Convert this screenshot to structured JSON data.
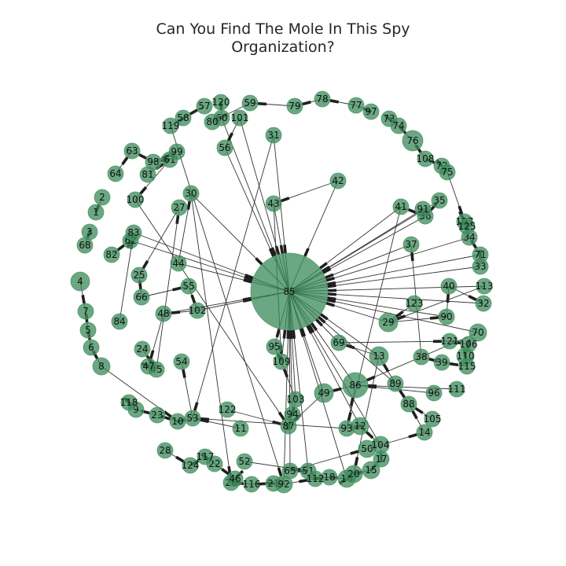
{
  "title_lines": [
    "Can You Find The Mole In This Spy",
    "Organization?"
  ],
  "colors": {
    "node_fill": "#3b8a5a",
    "node_stroke": "#4f9a6a",
    "edge": "#333333",
    "background": "#ffffff"
  },
  "diagram": {
    "type": "directed network graph",
    "nodes": [
      {
        "id": "1"
      },
      {
        "id": "2"
      },
      {
        "id": "3"
      },
      {
        "id": "4"
      },
      {
        "id": "5"
      },
      {
        "id": "6"
      },
      {
        "id": "7"
      },
      {
        "id": "8"
      },
      {
        "id": "9"
      },
      {
        "id": "10"
      },
      {
        "id": "11"
      },
      {
        "id": "12"
      },
      {
        "id": "13"
      },
      {
        "id": "14"
      },
      {
        "id": "15"
      },
      {
        "id": "16"
      },
      {
        "id": "17"
      },
      {
        "id": "18"
      },
      {
        "id": "20"
      },
      {
        "id": "21"
      },
      {
        "id": "22"
      },
      {
        "id": "23"
      },
      {
        "id": "24"
      },
      {
        "id": "25"
      },
      {
        "id": "26"
      },
      {
        "id": "27"
      },
      {
        "id": "28"
      },
      {
        "id": "29"
      },
      {
        "id": "30"
      },
      {
        "id": "31"
      },
      {
        "id": "32"
      },
      {
        "id": "33"
      },
      {
        "id": "34"
      },
      {
        "id": "35"
      },
      {
        "id": "36"
      },
      {
        "id": "37"
      },
      {
        "id": "38"
      },
      {
        "id": "39"
      },
      {
        "id": "40"
      },
      {
        "id": "41"
      },
      {
        "id": "42"
      },
      {
        "id": "43"
      },
      {
        "id": "44"
      },
      {
        "id": "45"
      },
      {
        "id": "46"
      },
      {
        "id": "47"
      },
      {
        "id": "48"
      },
      {
        "id": "49"
      },
      {
        "id": "50"
      },
      {
        "id": "51"
      },
      {
        "id": "52"
      },
      {
        "id": "53"
      },
      {
        "id": "54"
      },
      {
        "id": "55"
      },
      {
        "id": "56"
      },
      {
        "id": "57"
      },
      {
        "id": "58"
      },
      {
        "id": "59"
      },
      {
        "id": "60"
      },
      {
        "id": "61"
      },
      {
        "id": "62"
      },
      {
        "id": "63"
      },
      {
        "id": "64"
      },
      {
        "id": "65"
      },
      {
        "id": "66"
      },
      {
        "id": "68"
      },
      {
        "id": "69"
      },
      {
        "id": "70"
      },
      {
        "id": "71"
      },
      {
        "id": "72"
      },
      {
        "id": "73"
      },
      {
        "id": "74"
      },
      {
        "id": "75"
      },
      {
        "id": "76"
      },
      {
        "id": "77"
      },
      {
        "id": "78"
      },
      {
        "id": "79"
      },
      {
        "id": "80"
      },
      {
        "id": "81"
      },
      {
        "id": "82"
      },
      {
        "id": "83"
      },
      {
        "id": "84"
      },
      {
        "id": "85"
      },
      {
        "id": "86"
      },
      {
        "id": "87"
      },
      {
        "id": "88"
      },
      {
        "id": "89"
      },
      {
        "id": "90"
      },
      {
        "id": "91"
      },
      {
        "id": "92"
      },
      {
        "id": "93"
      },
      {
        "id": "94"
      },
      {
        "id": "95"
      },
      {
        "id": "96"
      },
      {
        "id": "97"
      },
      {
        "id": "98"
      },
      {
        "id": "99"
      },
      {
        "id": "100"
      },
      {
        "id": "101"
      },
      {
        "id": "102"
      },
      {
        "id": "103"
      },
      {
        "id": "104"
      },
      {
        "id": "105"
      },
      {
        "id": "106"
      },
      {
        "id": "107"
      },
      {
        "id": "108"
      },
      {
        "id": "109"
      },
      {
        "id": "110"
      },
      {
        "id": "111"
      },
      {
        "id": "112"
      },
      {
        "id": "113"
      },
      {
        "id": "115"
      },
      {
        "id": "116"
      },
      {
        "id": "117"
      },
      {
        "id": "118"
      },
      {
        "id": "119"
      },
      {
        "id": "120"
      },
      {
        "id": "121"
      },
      {
        "id": "122"
      },
      {
        "id": "123"
      },
      {
        "id": "124"
      },
      {
        "id": "125"
      }
    ],
    "edges": [
      [
        "31",
        "85"
      ],
      [
        "42",
        "85"
      ],
      [
        "43",
        "85"
      ],
      [
        "37",
        "85"
      ],
      [
        "41",
        "85"
      ],
      [
        "36",
        "85"
      ],
      [
        "91",
        "85"
      ],
      [
        "35",
        "85"
      ],
      [
        "34",
        "85"
      ],
      [
        "33",
        "85"
      ],
      [
        "71",
        "85"
      ],
      [
        "113",
        "85"
      ],
      [
        "32",
        "85"
      ],
      [
        "29",
        "85"
      ],
      [
        "70",
        "85"
      ],
      [
        "90",
        "85"
      ],
      [
        "13",
        "85"
      ],
      [
        "69",
        "85"
      ],
      [
        "86",
        "85"
      ],
      [
        "89",
        "85"
      ],
      [
        "49",
        "85"
      ],
      [
        "12",
        "85"
      ],
      [
        "104",
        "85"
      ],
      [
        "16",
        "85"
      ],
      [
        "51",
        "85"
      ],
      [
        "65",
        "85"
      ],
      [
        "92",
        "85"
      ],
      [
        "103",
        "85"
      ],
      [
        "94",
        "85"
      ],
      [
        "109",
        "85"
      ],
      [
        "95",
        "85"
      ],
      [
        "102",
        "85"
      ],
      [
        "48",
        "85"
      ],
      [
        "44",
        "85"
      ],
      [
        "30",
        "85"
      ],
      [
        "56",
        "85"
      ],
      [
        "101",
        "85"
      ],
      [
        "60",
        "85"
      ],
      [
        "83",
        "85"
      ],
      [
        "62",
        "85"
      ],
      [
        "98",
        "99"
      ],
      [
        "99",
        "100"
      ],
      [
        "58",
        "57"
      ],
      [
        "57",
        "119"
      ],
      [
        "59",
        "80"
      ],
      [
        "120",
        "60"
      ],
      [
        "101",
        "56"
      ],
      [
        "61",
        "98"
      ],
      [
        "62",
        "83"
      ],
      [
        "82",
        "62"
      ],
      [
        "84",
        "83"
      ],
      [
        "25",
        "66"
      ],
      [
        "66",
        "55"
      ],
      [
        "55",
        "102"
      ],
      [
        "102",
        "48"
      ],
      [
        "48",
        "47"
      ],
      [
        "47",
        "45"
      ],
      [
        "24",
        "45"
      ],
      [
        "45",
        "27"
      ],
      [
        "27",
        "25"
      ],
      [
        "44",
        "30"
      ],
      [
        "30",
        "26"
      ],
      [
        "23",
        "10"
      ],
      [
        "10",
        "53"
      ],
      [
        "53",
        "54"
      ],
      [
        "118",
        "9"
      ],
      [
        "9",
        "23"
      ],
      [
        "1",
        "2"
      ],
      [
        "3",
        "68"
      ],
      [
        "4",
        "7"
      ],
      [
        "7",
        "5"
      ],
      [
        "5",
        "6"
      ],
      [
        "6",
        "8"
      ],
      [
        "8",
        "10"
      ],
      [
        "28",
        "124"
      ],
      [
        "124",
        "117"
      ],
      [
        "117",
        "22"
      ],
      [
        "22",
        "46"
      ],
      [
        "46",
        "26"
      ],
      [
        "26",
        "116"
      ],
      [
        "116",
        "21"
      ],
      [
        "21",
        "92"
      ],
      [
        "92",
        "112"
      ],
      [
        "112",
        "18"
      ],
      [
        "18",
        "16"
      ],
      [
        "16",
        "20"
      ],
      [
        "20",
        "15"
      ],
      [
        "15",
        "17"
      ],
      [
        "17",
        "104"
      ],
      [
        "104",
        "12"
      ],
      [
        "12",
        "93"
      ],
      [
        "93",
        "86"
      ],
      [
        "86",
        "49"
      ],
      [
        "49",
        "87"
      ],
      [
        "87",
        "94"
      ],
      [
        "94",
        "103"
      ],
      [
        "103",
        "109"
      ],
      [
        "109",
        "95"
      ],
      [
        "11",
        "53"
      ],
      [
        "122",
        "87"
      ],
      [
        "52",
        "51"
      ],
      [
        "51",
        "65"
      ],
      [
        "65",
        "50"
      ],
      [
        "50",
        "14"
      ],
      [
        "14",
        "88"
      ],
      [
        "88",
        "89"
      ],
      [
        "89",
        "13"
      ],
      [
        "13",
        "69"
      ],
      [
        "69",
        "121"
      ],
      [
        "121",
        "106"
      ],
      [
        "106",
        "110"
      ],
      [
        "110",
        "115"
      ],
      [
        "115",
        "39"
      ],
      [
        "39",
        "38"
      ],
      [
        "38",
        "37"
      ],
      [
        "123",
        "29"
      ],
      [
        "29",
        "90"
      ],
      [
        "90",
        "40"
      ],
      [
        "40",
        "32"
      ],
      [
        "113",
        "29"
      ],
      [
        "70",
        "86"
      ],
      [
        "96",
        "86"
      ],
      [
        "111",
        "86"
      ],
      [
        "105",
        "88"
      ],
      [
        "97",
        "77"
      ],
      [
        "77",
        "78"
      ],
      [
        "78",
        "79"
      ],
      [
        "79",
        "59"
      ],
      [
        "73",
        "74"
      ],
      [
        "74",
        "76"
      ],
      [
        "76",
        "108"
      ],
      [
        "108",
        "72"
      ],
      [
        "72",
        "75"
      ],
      [
        "75",
        "107"
      ],
      [
        "107",
        "125"
      ],
      [
        "125",
        "34"
      ],
      [
        "34",
        "71"
      ],
      [
        "71",
        "33"
      ],
      [
        "35",
        "36"
      ],
      [
        "36",
        "41"
      ],
      [
        "41",
        "93"
      ],
      [
        "42",
        "43"
      ],
      [
        "43",
        "109"
      ],
      [
        "31",
        "53"
      ],
      [
        "81",
        "61"
      ],
      [
        "64",
        "63"
      ],
      [
        "63",
        "98"
      ],
      [
        "100",
        "87"
      ],
      [
        "119",
        "92"
      ],
      [
        "13",
        "20"
      ],
      [
        "93",
        "53"
      ]
    ]
  }
}
